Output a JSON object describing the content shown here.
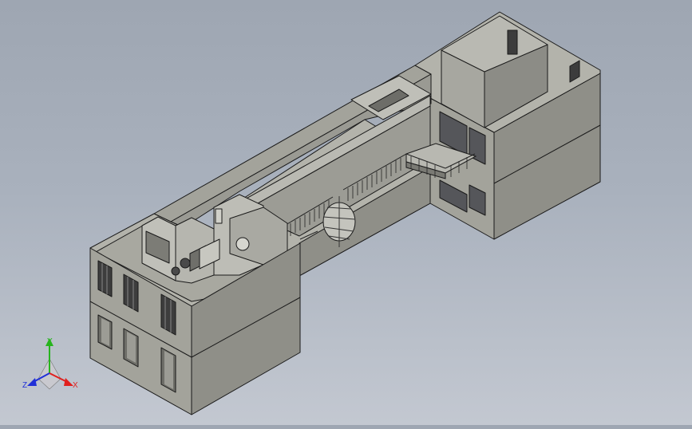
{
  "viewport": {
    "background_top": "#9ea6b2",
    "background_bottom": "#c3c8d1"
  },
  "model": {
    "wall_light": "#a3a39b",
    "wall_mid": "#8f8f88",
    "wall_dark": "#7a7a74",
    "edge": "#1a1a1a",
    "floor": "#b3b3ab"
  },
  "triad": {
    "x_label": "X",
    "y_label": "Y",
    "z_label": "Z",
    "x_color": "#e0201e",
    "y_color": "#27b41e",
    "z_color": "#2030d8"
  }
}
